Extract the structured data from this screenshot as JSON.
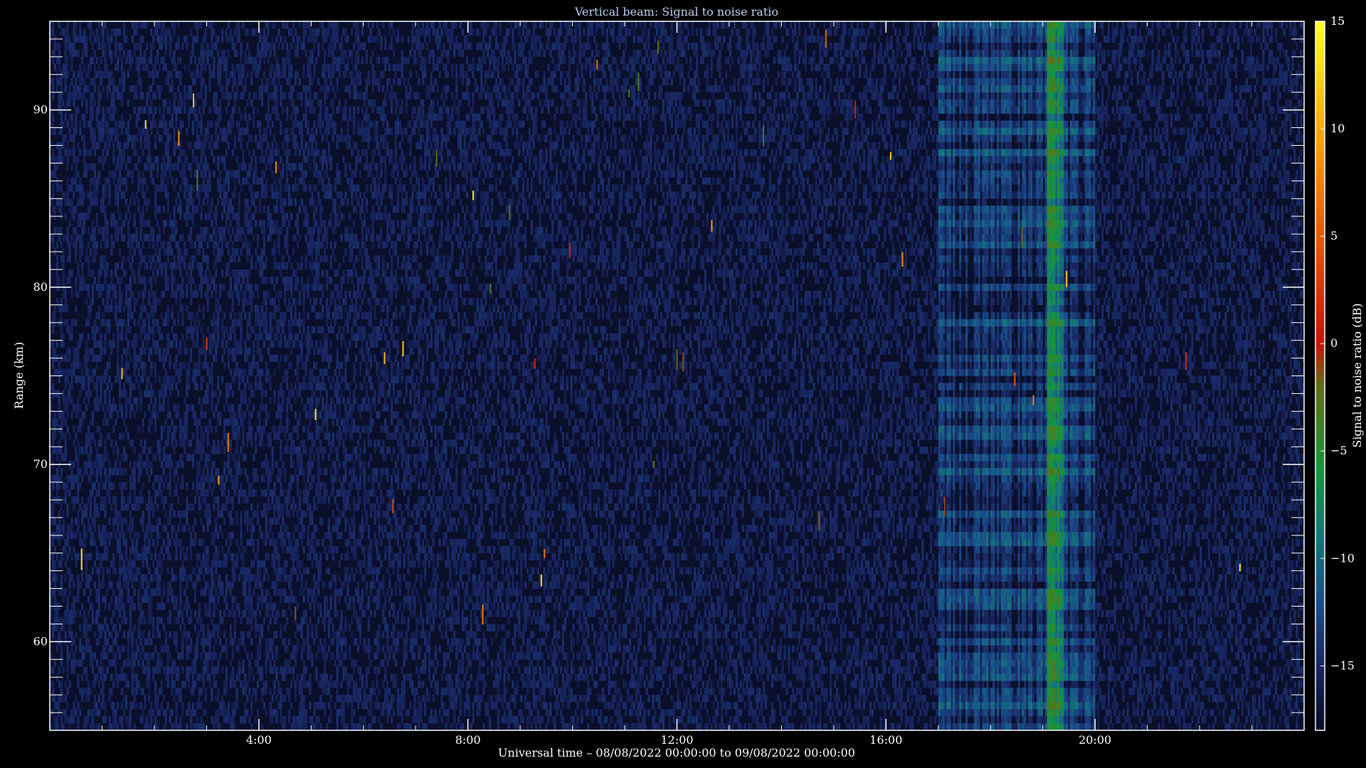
{
  "chart_data": {
    "type": "heatmap",
    "title": "Vertical beam: Signal to noise ratio",
    "xlabel": "Universal time – 08/08/2022 00:00:00 to 09/08/2022 00:00:00",
    "ylabel": "Range (km)",
    "colorbar_label": "Signal to noise ratio (dB)",
    "x_ticks": [
      "4:00",
      "8:00",
      "12:00",
      "16:00",
      "20:00"
    ],
    "x_tick_hours": [
      4,
      8,
      12,
      16,
      20
    ],
    "x_range_hours": [
      0,
      24
    ],
    "y_ticks": [
      "60",
      "70",
      "80",
      "90"
    ],
    "y_tick_values": [
      60,
      70,
      80,
      90
    ],
    "y_range_km": [
      55,
      95
    ],
    "colorbar_ticks": [
      "15",
      "10",
      "5",
      "0",
      "−5",
      "−10",
      "−15"
    ],
    "colorbar_values": [
      15,
      10,
      5,
      0,
      -5,
      -10,
      -15
    ],
    "colorbar_range_db": [
      -18,
      15
    ],
    "background_db": -18,
    "echo_region_hours": [
      17.0,
      20.0
    ],
    "strong_echo_hours": [
      19.1,
      19.4
    ],
    "colors": {
      "background": "#000000",
      "plot_floor": "#0a0f2a",
      "axes": "#ffffff",
      "title": "#b8d0f0"
    }
  }
}
